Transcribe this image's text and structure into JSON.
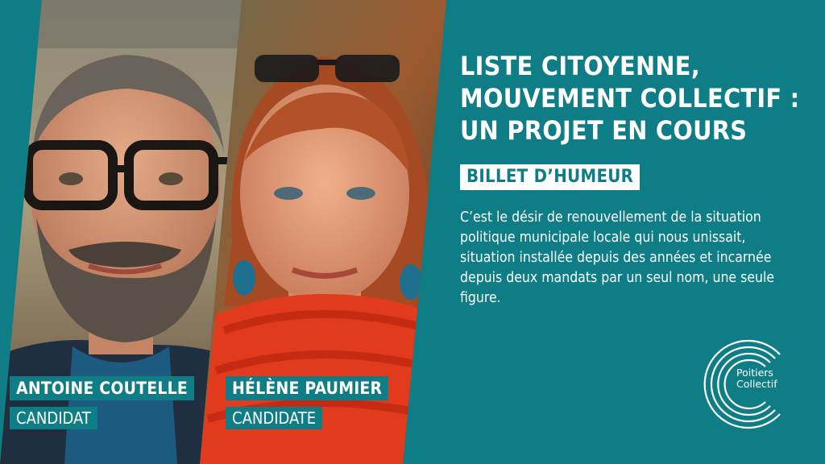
{
  "headline": {
    "lines": [
      "LISTE CITOYENNE,",
      "MOUVEMENT COLLECTIF :",
      "UN PROJET EN COURS"
    ]
  },
  "badge": "BILLET D’HUMEUR",
  "body": "C’est le désir de renouvellement de la situation politique municipale locale qui nous unissait, situation installée depuis des années et incarnée depuis deux mandats par un seul nom, une seule figure.",
  "people": [
    {
      "name": "ANTOINE COUTELLE",
      "role": "CANDIDAT"
    },
    {
      "name": "HÉLÈNE PAUMIER",
      "role": "CANDIDATE"
    }
  ],
  "logo": {
    "line1": "Poitiers",
    "line2": "Collectif"
  },
  "colors": {
    "brand_teal": "#0f7d86",
    "white": "#ffffff",
    "scarf_red": "#e23a1c"
  }
}
